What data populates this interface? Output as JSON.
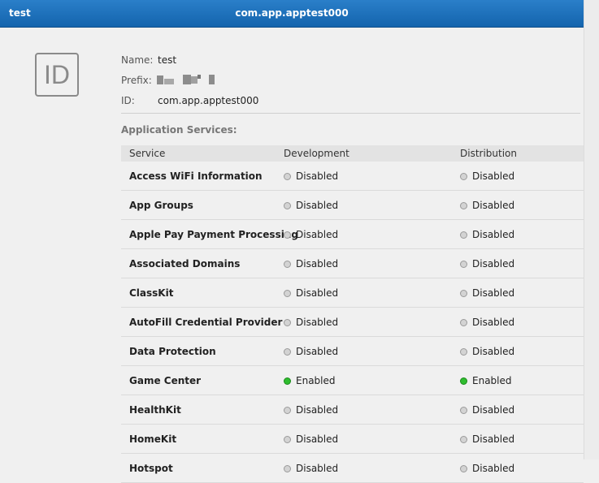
{
  "header": {
    "left_title": "test",
    "center_title": "com.app.apptest000"
  },
  "app_id": {
    "icon_text": "ID",
    "name_label": "Name:",
    "name_value": "test",
    "prefix_label": "Prefix:",
    "id_label": "ID:",
    "id_value": "com.app.apptest000"
  },
  "services": {
    "section_title": "Application Services:",
    "columns": {
      "service": "Service",
      "development": "Development",
      "distribution": "Distribution"
    },
    "rows": [
      {
        "name": "Access WiFi Information",
        "dev": "Disabled",
        "dist": "Disabled"
      },
      {
        "name": "App Groups",
        "dev": "Disabled",
        "dist": "Disabled"
      },
      {
        "name": "Apple Pay Payment Processing",
        "dev": "Disabled",
        "dist": "Disabled"
      },
      {
        "name": "Associated Domains",
        "dev": "Disabled",
        "dist": "Disabled"
      },
      {
        "name": "ClassKit",
        "dev": "Disabled",
        "dist": "Disabled"
      },
      {
        "name": "AutoFill Credential Provider",
        "dev": "Disabled",
        "dist": "Disabled"
      },
      {
        "name": "Data Protection",
        "dev": "Disabled",
        "dist": "Disabled"
      },
      {
        "name": "Game Center",
        "dev": "Enabled",
        "dist": "Enabled"
      },
      {
        "name": "HealthKit",
        "dev": "Disabled",
        "dist": "Disabled"
      },
      {
        "name": "HomeKit",
        "dev": "Disabled",
        "dist": "Disabled"
      },
      {
        "name": "Hotspot",
        "dev": "Disabled",
        "dist": "Disabled"
      }
    ]
  },
  "colors": {
    "header_blue": "#1a6fbb",
    "enabled_green": "#2fbd2f",
    "disabled_gray": "#d3d3d3"
  }
}
